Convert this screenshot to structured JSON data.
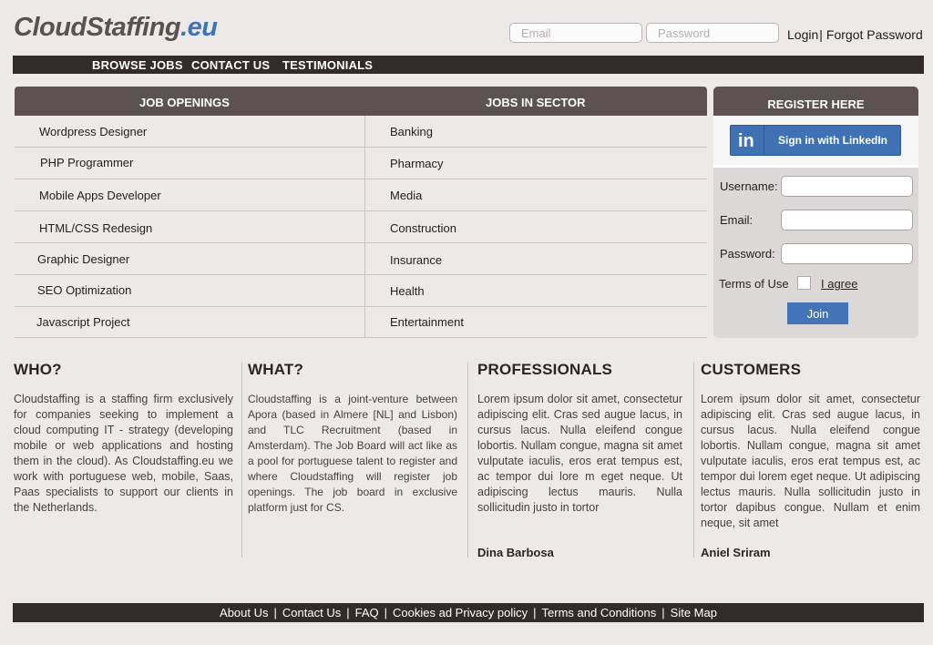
{
  "logo": {
    "part1": "CloudStaffing",
    "part2": ".eu"
  },
  "login": {
    "email_placeholder": "Email",
    "password_placeholder": "Password",
    "login_label": "Login",
    "separator": "|",
    "forgot_label": "Forgot Password"
  },
  "nav": {
    "items": [
      "BROWSE JOBS",
      "CONTACT US",
      "TESTIMONIALS"
    ]
  },
  "jobs": {
    "openings_title": "JOB OPENINGS",
    "sector_title": "JOBS IN SECTOR",
    "openings": [
      "Wordpress Designer",
      "PHP Programmer",
      "Mobile Apps Developer",
      "HTML/CSS Redesign",
      "Graphic Designer",
      "SEO Optimization",
      "Javascript Project"
    ],
    "sectors": [
      "Banking",
      "Pharmacy",
      "Media",
      "Construction",
      "Insurance",
      "Health",
      "Entertainment"
    ]
  },
  "register": {
    "title": "REGISTER HERE",
    "linkedin_logo": "in",
    "linkedin_label": "Sign in with LinkedIn",
    "username_label": "Username:",
    "email_label": "Email:",
    "password_label": "Password:",
    "terms_label": "Terms of Use",
    "agree_label": "I agree",
    "join_label": "Join"
  },
  "who": {
    "title": "WHO?",
    "text": "Cloudstaffing is a staffing firm exclusively for companies seeking to implement a cloud computing IT - strategy (developing mobile or web applications and hosting them in the cloud). As Cloudstaffing.eu we work with portuguese web, mobile, Saas, Paas specialists to support our clients in the Netherlands."
  },
  "what": {
    "title": "WHAT?",
    "text": "Cloudstaffing is a joint-venture between Apora (based in Almere [NL] and Lisbon) and TLC Recruitment (based in Amsterdam). The Job Board will act like as a pool for portuguese talent to register and where Cloudstaffing will register job openings. The job board in exclusive platform just for CS."
  },
  "professionals": {
    "title": "PROFESSIONALS",
    "text": "Lorem ipsum dolor sit amet, consectetur adipiscing elit. Cras sed augue lacus, in cursus lacus. Nulla eleifend congue lobortis. Nullam congue, magna sit amet vulputate iaculis, eros erat tempus est, ac tempor dui lore m eget neque. Ut adipiscing lectus mauris. Nulla sollicitudin justo in tortor",
    "author": "Dina Barbosa"
  },
  "customers": {
    "title": "CUSTOMERS",
    "text": "Lorem ipsum dolor sit amet, consectetur adipiscing elit. Cras sed augue lacus, in cursus lacus. Nulla eleifend congue lobortis. Nullam congue, magna sit amet vulputate iaculis, eros erat tempus est, ac tempor dui lorem eget neque. Ut adipiscing lectus mauris. Nulla sollicitudin justo in tortor dapibus congue. Nullam et enim neque, sit amet",
    "author": "Aniel Sriram"
  },
  "footer": {
    "links": [
      "About Us",
      "Contact Us",
      "FAQ",
      "Cookies ad Privacy policy",
      "Terms and Conditions",
      "Site Map"
    ],
    "separator": "|"
  },
  "colors": {
    "brand_dark": "#332b2a",
    "header_gray": "#5c5252",
    "accent_blue": "#3d74b6",
    "background": "#ede9e8"
  }
}
